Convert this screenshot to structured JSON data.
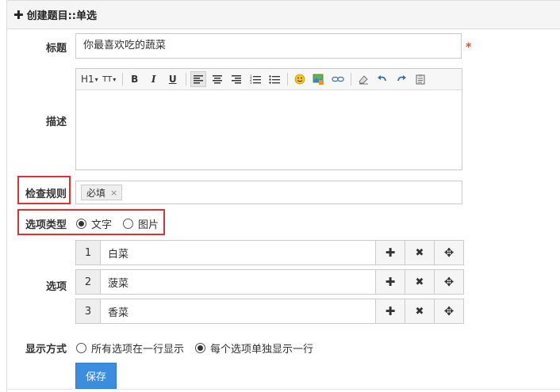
{
  "header": {
    "title": "创建题目::单选"
  },
  "fields": {
    "title_label": "标题",
    "title_value": "你最喜欢吃的蔬菜",
    "required_mark": "*",
    "desc_label": "描述",
    "rule_label": "检查规则",
    "rule_tag": "必填",
    "rule_tag_remove": "×",
    "type_label": "选项类型",
    "type_options": [
      "文字",
      "图片"
    ],
    "type_selected": "文字",
    "options_label": "选项",
    "display_label": "显示方式",
    "display_options": [
      "所有选项在一行显示",
      "每个选项单独显示一行"
    ],
    "display_selected": "每个选项单独显示一行",
    "save_label": "保存"
  },
  "toolbar": {
    "heading": "H1",
    "fontsize": "TT",
    "bold": "B",
    "italic": "I",
    "underline": "U"
  },
  "options": [
    {
      "num": "1",
      "text": "白菜"
    },
    {
      "num": "2",
      "text": "菠菜"
    },
    {
      "num": "3",
      "text": "香菜"
    }
  ],
  "option_buttons": {
    "add": "✚",
    "remove": "✖",
    "move": "✥"
  },
  "colors": {
    "primary": "#3c8dde",
    "highlight_border": "#e03030",
    "required": "#e74c3c"
  }
}
